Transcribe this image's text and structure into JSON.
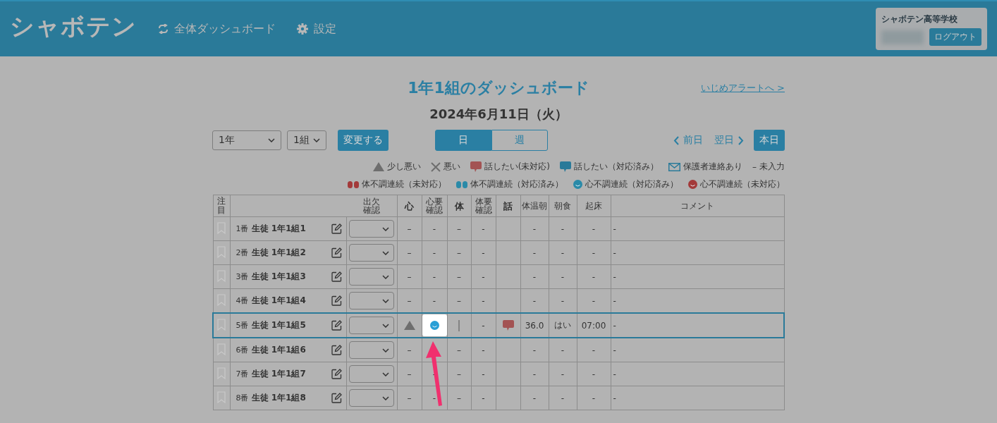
{
  "header": {
    "logo": "シャボテン",
    "nav": [
      {
        "kind": "sync",
        "label": "全体ダッシュボード"
      },
      {
        "kind": "gear",
        "label": "設定"
      }
    ],
    "account": {
      "school": "シャボテン高等学校",
      "logout": "ログアウト"
    }
  },
  "page": {
    "title": "1年1組のダッシュボード",
    "alert_link": "いじめアラートへ >",
    "date": "2024年6月11日（火）"
  },
  "controls": {
    "selects": [
      {
        "value": "1年"
      },
      {
        "value": "1組"
      }
    ],
    "change_button": "変更する",
    "view_tabs": [
      {
        "label": "日",
        "selected": true
      },
      {
        "label": "週",
        "selected": false
      }
    ],
    "prev": "前日",
    "next": "翌日",
    "today": "本日"
  },
  "legend": [
    [
      {
        "kind": "triangle",
        "label": "少し悪い"
      },
      {
        "kind": "cross",
        "label": "悪い"
      },
      {
        "kind": "speech",
        "color": "#a35353",
        "label": "話したい(未対応)"
      },
      {
        "kind": "speech",
        "color": "#2a7a99",
        "label": "話したい（対応済み）"
      },
      {
        "kind": "mail",
        "label": "保護者連絡あり"
      },
      {
        "kind": "symbol",
        "symbol": "–",
        "label": "未入力"
      }
    ],
    [
      {
        "kind": "pills",
        "color": "#a33a3a",
        "label": "体不調連続（未対応）"
      },
      {
        "kind": "pills",
        "color": "#2a8aa8",
        "label": "体不調連続（対応済み）"
      },
      {
        "kind": "face",
        "color": "#2a8aa8",
        "label": "心不調連続（対応済み）"
      },
      {
        "kind": "face",
        "color": "#a33a3a",
        "label": "心不調連続（未対応）"
      }
    ]
  ],
  "table": {
    "attention_header": "注目",
    "attendance_header": "出欠確認",
    "columns": [
      "心",
      "心要確認",
      "体",
      "体要確認",
      "話",
      "体温朝",
      "朝食",
      "起床",
      "コメント"
    ],
    "rows": [
      {
        "number": "1番",
        "name": "生徒 1年1組1",
        "selected": false,
        "cells": [
          {
            "kind": "text",
            "text": "–"
          },
          {
            "kind": "text",
            "text": "-"
          },
          {
            "kind": "text",
            "text": "–"
          },
          {
            "kind": "text",
            "text": "-"
          },
          {
            "kind": "empty"
          },
          {
            "kind": "text",
            "text": "-"
          },
          {
            "kind": "text",
            "text": "-"
          },
          {
            "kind": "text",
            "text": "-"
          },
          {
            "kind": "comment",
            "text": "-"
          }
        ]
      },
      {
        "number": "2番",
        "name": "生徒 1年1組2",
        "selected": false,
        "cells": [
          {
            "kind": "text",
            "text": "–"
          },
          {
            "kind": "text",
            "text": "-"
          },
          {
            "kind": "text",
            "text": "–"
          },
          {
            "kind": "text",
            "text": "-"
          },
          {
            "kind": "empty"
          },
          {
            "kind": "text",
            "text": "-"
          },
          {
            "kind": "text",
            "text": "-"
          },
          {
            "kind": "text",
            "text": "-"
          },
          {
            "kind": "comment",
            "text": "-"
          }
        ]
      },
      {
        "number": "3番",
        "name": "生徒 1年1組3",
        "selected": false,
        "cells": [
          {
            "kind": "text",
            "text": "–"
          },
          {
            "kind": "text",
            "text": "-"
          },
          {
            "kind": "text",
            "text": "–"
          },
          {
            "kind": "text",
            "text": "-"
          },
          {
            "kind": "empty"
          },
          {
            "kind": "text",
            "text": "-"
          },
          {
            "kind": "text",
            "text": "-"
          },
          {
            "kind": "text",
            "text": "-"
          },
          {
            "kind": "comment",
            "text": "-"
          }
        ]
      },
      {
        "number": "4番",
        "name": "生徒 1年1組4",
        "selected": false,
        "cells": [
          {
            "kind": "text",
            "text": "–"
          },
          {
            "kind": "text",
            "text": "-"
          },
          {
            "kind": "text",
            "text": "–"
          },
          {
            "kind": "text",
            "text": "-"
          },
          {
            "kind": "empty"
          },
          {
            "kind": "text",
            "text": "-"
          },
          {
            "kind": "text",
            "text": "-"
          },
          {
            "kind": "text",
            "text": "-"
          },
          {
            "kind": "comment",
            "text": "-"
          }
        ]
      },
      {
        "number": "5番",
        "name": "生徒 1年1組5",
        "selected": true,
        "cells": [
          {
            "kind": "triangle"
          },
          {
            "kind": "face",
            "color": "#2a9fd6",
            "highlighted": true
          },
          {
            "kind": "bar"
          },
          {
            "kind": "text",
            "text": "-"
          },
          {
            "kind": "speech",
            "color": "#a35353"
          },
          {
            "kind": "text",
            "text": "36.0"
          },
          {
            "kind": "text",
            "text": "はい"
          },
          {
            "kind": "text",
            "text": "07:00"
          },
          {
            "kind": "comment",
            "text": "-"
          }
        ]
      },
      {
        "number": "6番",
        "name": "生徒 1年1組6",
        "selected": false,
        "cells": [
          {
            "kind": "text",
            "text": "–"
          },
          {
            "kind": "empty"
          },
          {
            "kind": "text",
            "text": "–"
          },
          {
            "kind": "text",
            "text": "-"
          },
          {
            "kind": "empty"
          },
          {
            "kind": "text",
            "text": "-"
          },
          {
            "kind": "text",
            "text": "-"
          },
          {
            "kind": "text",
            "text": "-"
          },
          {
            "kind": "comment",
            "text": "-"
          }
        ]
      },
      {
        "number": "7番",
        "name": "生徒 1年1組7",
        "selected": false,
        "cells": [
          {
            "kind": "text",
            "text": "–"
          },
          {
            "kind": "text",
            "text": "-"
          },
          {
            "kind": "text",
            "text": "–"
          },
          {
            "kind": "text",
            "text": "-"
          },
          {
            "kind": "empty"
          },
          {
            "kind": "text",
            "text": "-"
          },
          {
            "kind": "text",
            "text": "-"
          },
          {
            "kind": "text",
            "text": "-"
          },
          {
            "kind": "comment",
            "text": "-"
          }
        ]
      },
      {
        "number": "8番",
        "name": "生徒 1年1組8",
        "selected": false,
        "cells": [
          {
            "kind": "text",
            "text": "–"
          },
          {
            "kind": "text",
            "text": "-"
          },
          {
            "kind": "text",
            "text": "–"
          },
          {
            "kind": "text",
            "text": "-"
          },
          {
            "kind": "empty"
          },
          {
            "kind": "text",
            "text": "-"
          },
          {
            "kind": "text",
            "text": "-"
          },
          {
            "kind": "text",
            "text": "-"
          },
          {
            "kind": "comment",
            "text": "-"
          }
        ]
      }
    ]
  }
}
